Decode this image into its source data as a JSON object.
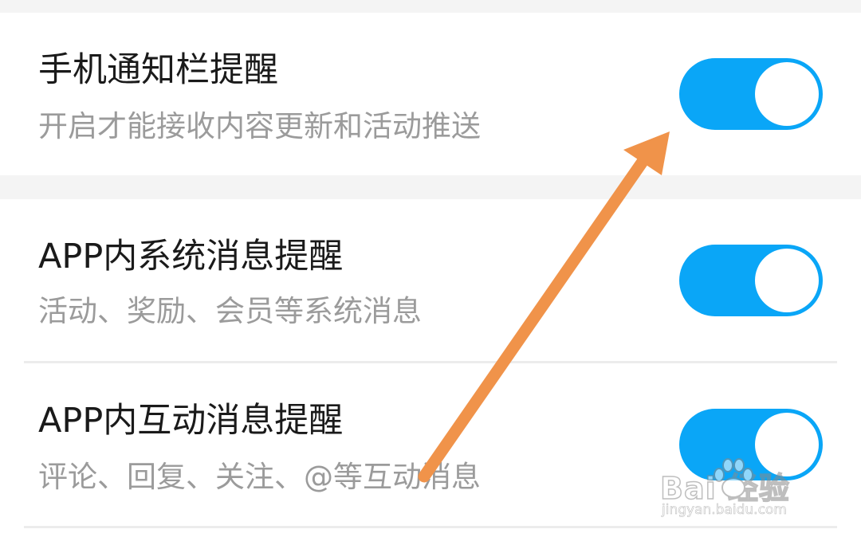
{
  "settings": [
    {
      "title": "手机通知栏提醒",
      "subtitle": "开启才能接收内容更新和活动推送",
      "enabled": true
    },
    {
      "title": "APP内系统消息提醒",
      "subtitle": "活动、奖励、会员等系统消息",
      "enabled": true
    },
    {
      "title": "APP内互动消息提醒",
      "subtitle": "评论、回复、关注、@等互动消息",
      "enabled": true
    }
  ],
  "colors": {
    "toggle_on": "#0aa6f7",
    "annotation_arrow": "#f0934a"
  },
  "watermark": {
    "brand": "Bai 经验",
    "url": "jingyan.baidu.com"
  }
}
